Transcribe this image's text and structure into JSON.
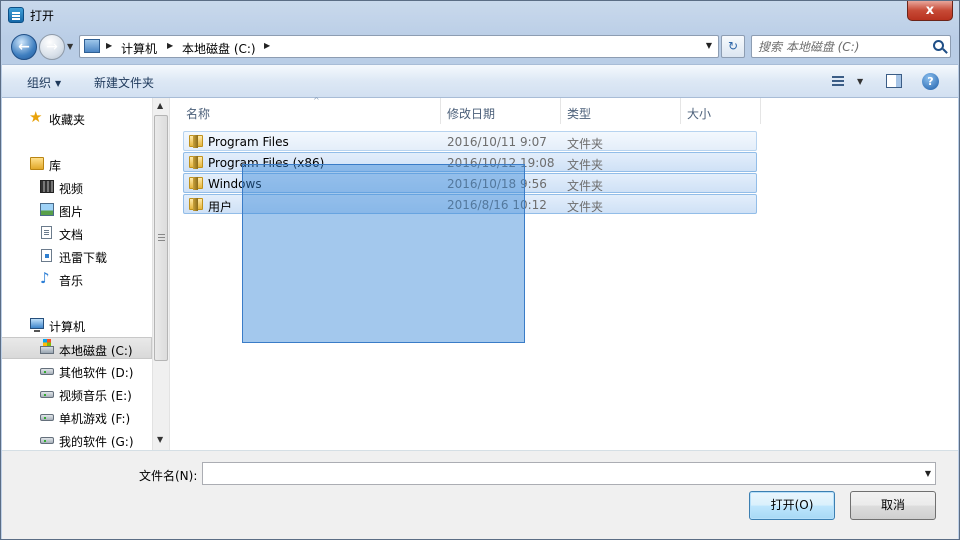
{
  "window": {
    "title": "打开",
    "close_label": "x"
  },
  "nav": {
    "back_glyph": "←",
    "forward_glyph": "→",
    "address": {
      "crumbs": [
        "计算机",
        "本地磁盘 (C:)"
      ],
      "separator_glyph": "▶",
      "dropdown_glyph": "▼"
    },
    "refresh_glyph": "↻",
    "search_placeholder": "搜索 本地磁盘 (C:)"
  },
  "toolbar": {
    "organize_label": "组织",
    "new_folder_label": "新建文件夹",
    "caret_glyph": "▼",
    "help_glyph": "?"
  },
  "sidebar": {
    "favorites": "收藏夹",
    "library": "库",
    "library_items": [
      "视频",
      "图片",
      "文档",
      "迅雷下载",
      "音乐"
    ],
    "computer": "计算机",
    "drives": [
      "本地磁盘 (C:)",
      "其他软件 (D:)",
      "视频音乐 (E:)",
      "单机游戏 (F:)",
      "我的软件 (G:)"
    ],
    "selected": "本地磁盘 (C:)",
    "scroll_up_glyph": "▲",
    "scroll_down_glyph": "▼",
    "star_glyph": "★",
    "note_glyph": "♪"
  },
  "columns": {
    "name": "名称",
    "date": "修改日期",
    "type": "类型",
    "size": "大小",
    "sort_glyph": "^"
  },
  "files": [
    {
      "name": "Program Files",
      "date": "2016/10/11 9:07",
      "type": "文件夹"
    },
    {
      "name": "Program Files (x86)",
      "date": "2016/10/12 19:08",
      "type": "文件夹"
    },
    {
      "name": "Windows",
      "date": "2016/10/18 9:56",
      "type": "文件夹"
    },
    {
      "name": "用户",
      "date": "2016/8/16 10:12",
      "type": "文件夹"
    }
  ],
  "bottom": {
    "filename_label": "文件名(N):",
    "filename_value": "",
    "dropdown_glyph": "▼",
    "open_label": "打开(O)",
    "cancel_label": "取消"
  },
  "colors": {
    "selection": "#3385d6",
    "toolbar": "#dde8f5",
    "close": "#c74a36"
  },
  "icons": [
    "app-icon",
    "back-icon",
    "forward-icon",
    "computer-icon",
    "refresh-icon",
    "search-icon",
    "view-icon",
    "preview-pane-icon",
    "help-icon",
    "star-icon",
    "library-icon",
    "video-icon",
    "picture-icon",
    "document-icon",
    "download-icon",
    "music-icon",
    "drive-icon",
    "folder-icon"
  ]
}
